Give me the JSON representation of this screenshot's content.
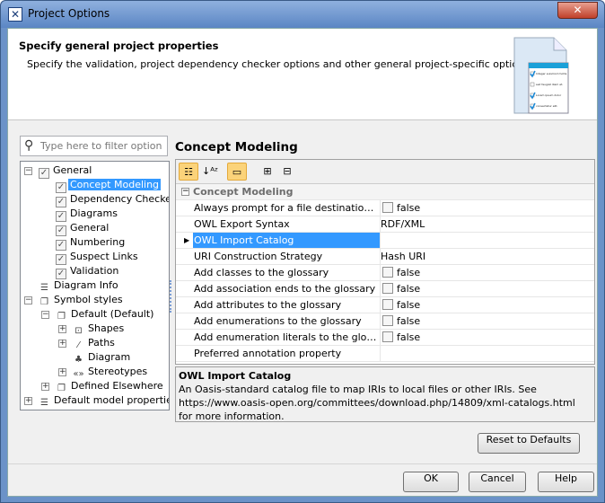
{
  "window": {
    "title": "Project Options"
  },
  "header": {
    "heading": "Specify general project properties",
    "description": "Specify the validation, project dependency checker options and other general project-specific options."
  },
  "filter": {
    "placeholder": "Type here to filter options"
  },
  "tree": [
    {
      "label": "General",
      "level": 0,
      "expander": "-",
      "icon": "checkbox",
      "name": "general"
    },
    {
      "label": "Concept Modeling",
      "level": 1,
      "icon": "checkbox",
      "selected": true,
      "name": "concept-modeling"
    },
    {
      "label": "Dependency Checker",
      "level": 1,
      "icon": "checkbox",
      "name": "dependency-checker"
    },
    {
      "label": "Diagrams",
      "level": 1,
      "icon": "checkbox",
      "name": "diagrams"
    },
    {
      "label": "General",
      "level": 1,
      "icon": "checkbox",
      "name": "general-sub"
    },
    {
      "label": "Numbering",
      "level": 1,
      "icon": "checkbox",
      "name": "numbering"
    },
    {
      "label": "Suspect Links",
      "level": 1,
      "icon": "checkbox",
      "name": "suspect-links"
    },
    {
      "label": "Validation",
      "level": 1,
      "icon": "checkbox",
      "name": "validation"
    },
    {
      "label": "Diagram Info",
      "level": 0,
      "icon": "table",
      "name": "diagram-info"
    },
    {
      "label": "Symbol styles",
      "level": 0,
      "expander": "-",
      "icon": "styles",
      "name": "symbol-styles"
    },
    {
      "label": "Default (Default)",
      "level": 1,
      "expander": "-",
      "icon": "styles",
      "name": "default-style"
    },
    {
      "label": "Shapes",
      "level": 2,
      "expander": "+",
      "icon": "shapes",
      "name": "shapes"
    },
    {
      "label": "Paths",
      "level": 2,
      "expander": "+",
      "icon": "path",
      "name": "paths"
    },
    {
      "label": "Diagram",
      "level": 2,
      "icon": "diagram",
      "name": "diagram"
    },
    {
      "label": "Stereotypes",
      "level": 2,
      "expander": "+",
      "icon": "stereotype",
      "name": "stereotypes"
    },
    {
      "label": "Defined Elsewhere",
      "level": 1,
      "expander": "+",
      "icon": "styles",
      "name": "defined-elsewhere"
    },
    {
      "label": "Default model properties",
      "level": 0,
      "expander": "+",
      "icon": "table",
      "name": "default-model-properties"
    }
  ],
  "panel": {
    "title": "Concept Modeling",
    "group": "Concept Modeling",
    "rows": [
      {
        "name": "Always prompt for a file destination whe...",
        "value": "false",
        "checkbox": true
      },
      {
        "name": "OWL Export Syntax",
        "value": "RDF/XML"
      },
      {
        "name": "OWL Import Catalog",
        "value": "",
        "selected": true
      },
      {
        "name": "URI Construction Strategy",
        "value": "Hash URI"
      },
      {
        "name": "Add classes to the glossary",
        "value": "false",
        "checkbox": true
      },
      {
        "name": "Add association ends to the glossary",
        "value": "false",
        "checkbox": true
      },
      {
        "name": "Add attributes to the glossary",
        "value": "false",
        "checkbox": true
      },
      {
        "name": "Add enumerations to the glossary",
        "value": "false",
        "checkbox": true
      },
      {
        "name": "Add enumeration literals to the glossary",
        "value": "false",
        "checkbox": true
      },
      {
        "name": "Preferred annotation property",
        "value": ""
      }
    ],
    "description_title": "OWL Import Catalog",
    "description": "An Oasis-standard catalog file to map IRIs to local files or other IRIs. See https://www.oasis-open.org/committees/download.php/14809/xml-catalogs.html for more information."
  },
  "buttons": {
    "reset": "Reset to Defaults",
    "ok": "OK",
    "cancel": "Cancel",
    "help": "Help"
  },
  "header_image": {
    "items": [
      "Integer euismod mollis",
      "sed feugiat diam et.",
      "Lorem ipsum dolor",
      "consectetur elit."
    ]
  }
}
